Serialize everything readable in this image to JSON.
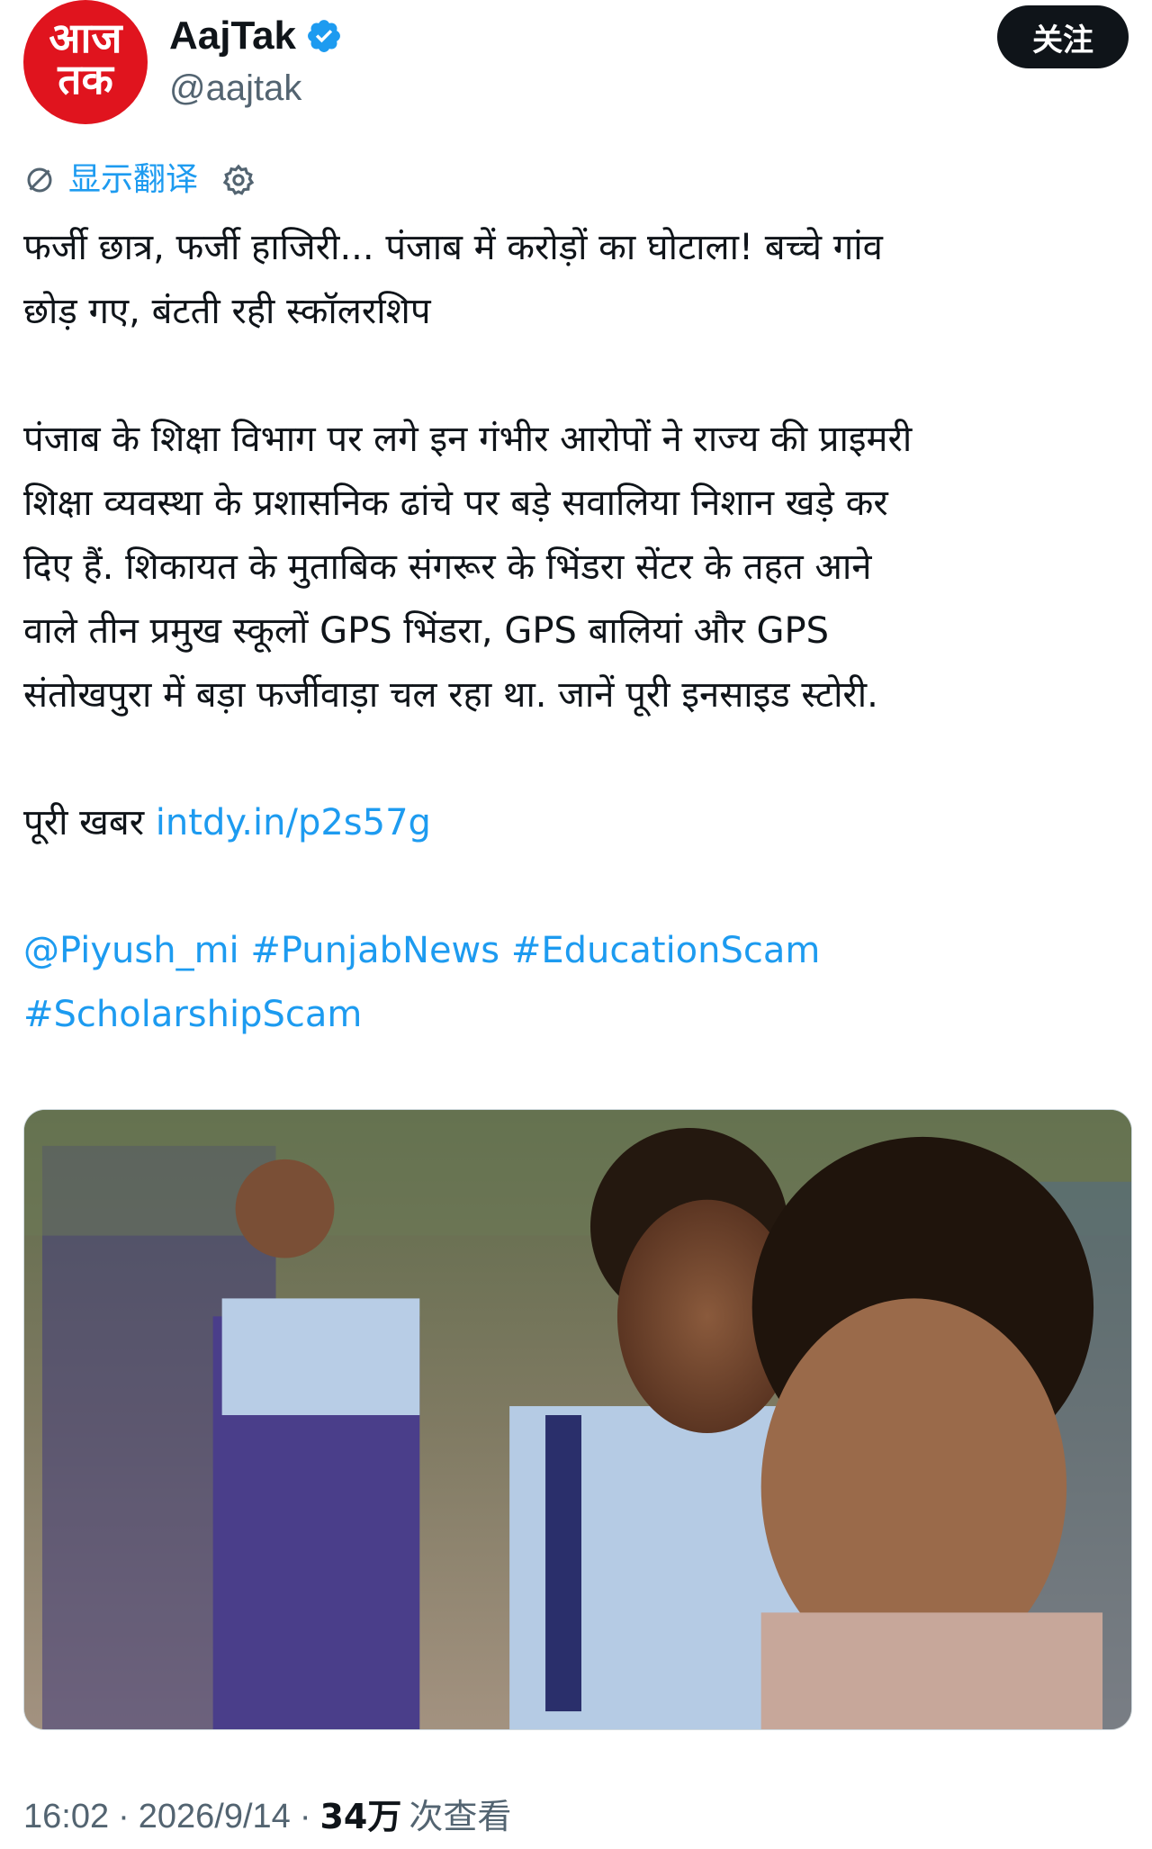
{
  "author": {
    "avatar_line1": "आज",
    "avatar_line2": "तक",
    "display_name": "AajTak",
    "handle": "@aajtak",
    "verified": true,
    "verified_color": "#1d9bf0"
  },
  "follow_button": {
    "label": "关注"
  },
  "translate": {
    "label": "显示翻译"
  },
  "tweet": {
    "headline_line1": "फर्जी छात्र, फर्जी हाजिरी... पंजाब में करोड़ों का घोटाला! बच्चे गांव",
    "headline_line2": "छोड़ गए, बंटती रही स्कॉलरशिप",
    "body_lines": [
      "पंजाब के शिक्षा विभाग पर लगे इन गंभीर आरोपों ने राज्य की प्राइमरी",
      "शिक्षा व्यवस्था के प्रशासनिक ढांचे पर बड़े सवालिया निशान खड़े कर",
      "दिए हैं. शिकायत के मुताबिक संगरूर के भिंडरा सेंटर के तहत आने",
      "वाले तीन प्रमुख स्कूलों GPS भिंडरा, GPS बालियां और GPS",
      "संतोखपुरा में बड़ा फर्जीवाड़ा चल रहा था. जानें पूरी इनसाइड स्टोरी."
    ],
    "full_news_label": "पूरी खबर",
    "link_text": "intdy.in/p2s57g",
    "mention": "@Piyush_mi",
    "hashtags": [
      "#PunjabNews",
      "#EducationScam",
      "#ScholarshipScam"
    ]
  },
  "meta": {
    "time": "16:02",
    "separator": "·",
    "date": "2026/9/14",
    "views_count": "34万",
    "views_label": "次查看"
  },
  "colors": {
    "link": "#1d9bf0",
    "text": "#0f1419",
    "muted": "#536471",
    "brand_red": "#e0141e"
  }
}
